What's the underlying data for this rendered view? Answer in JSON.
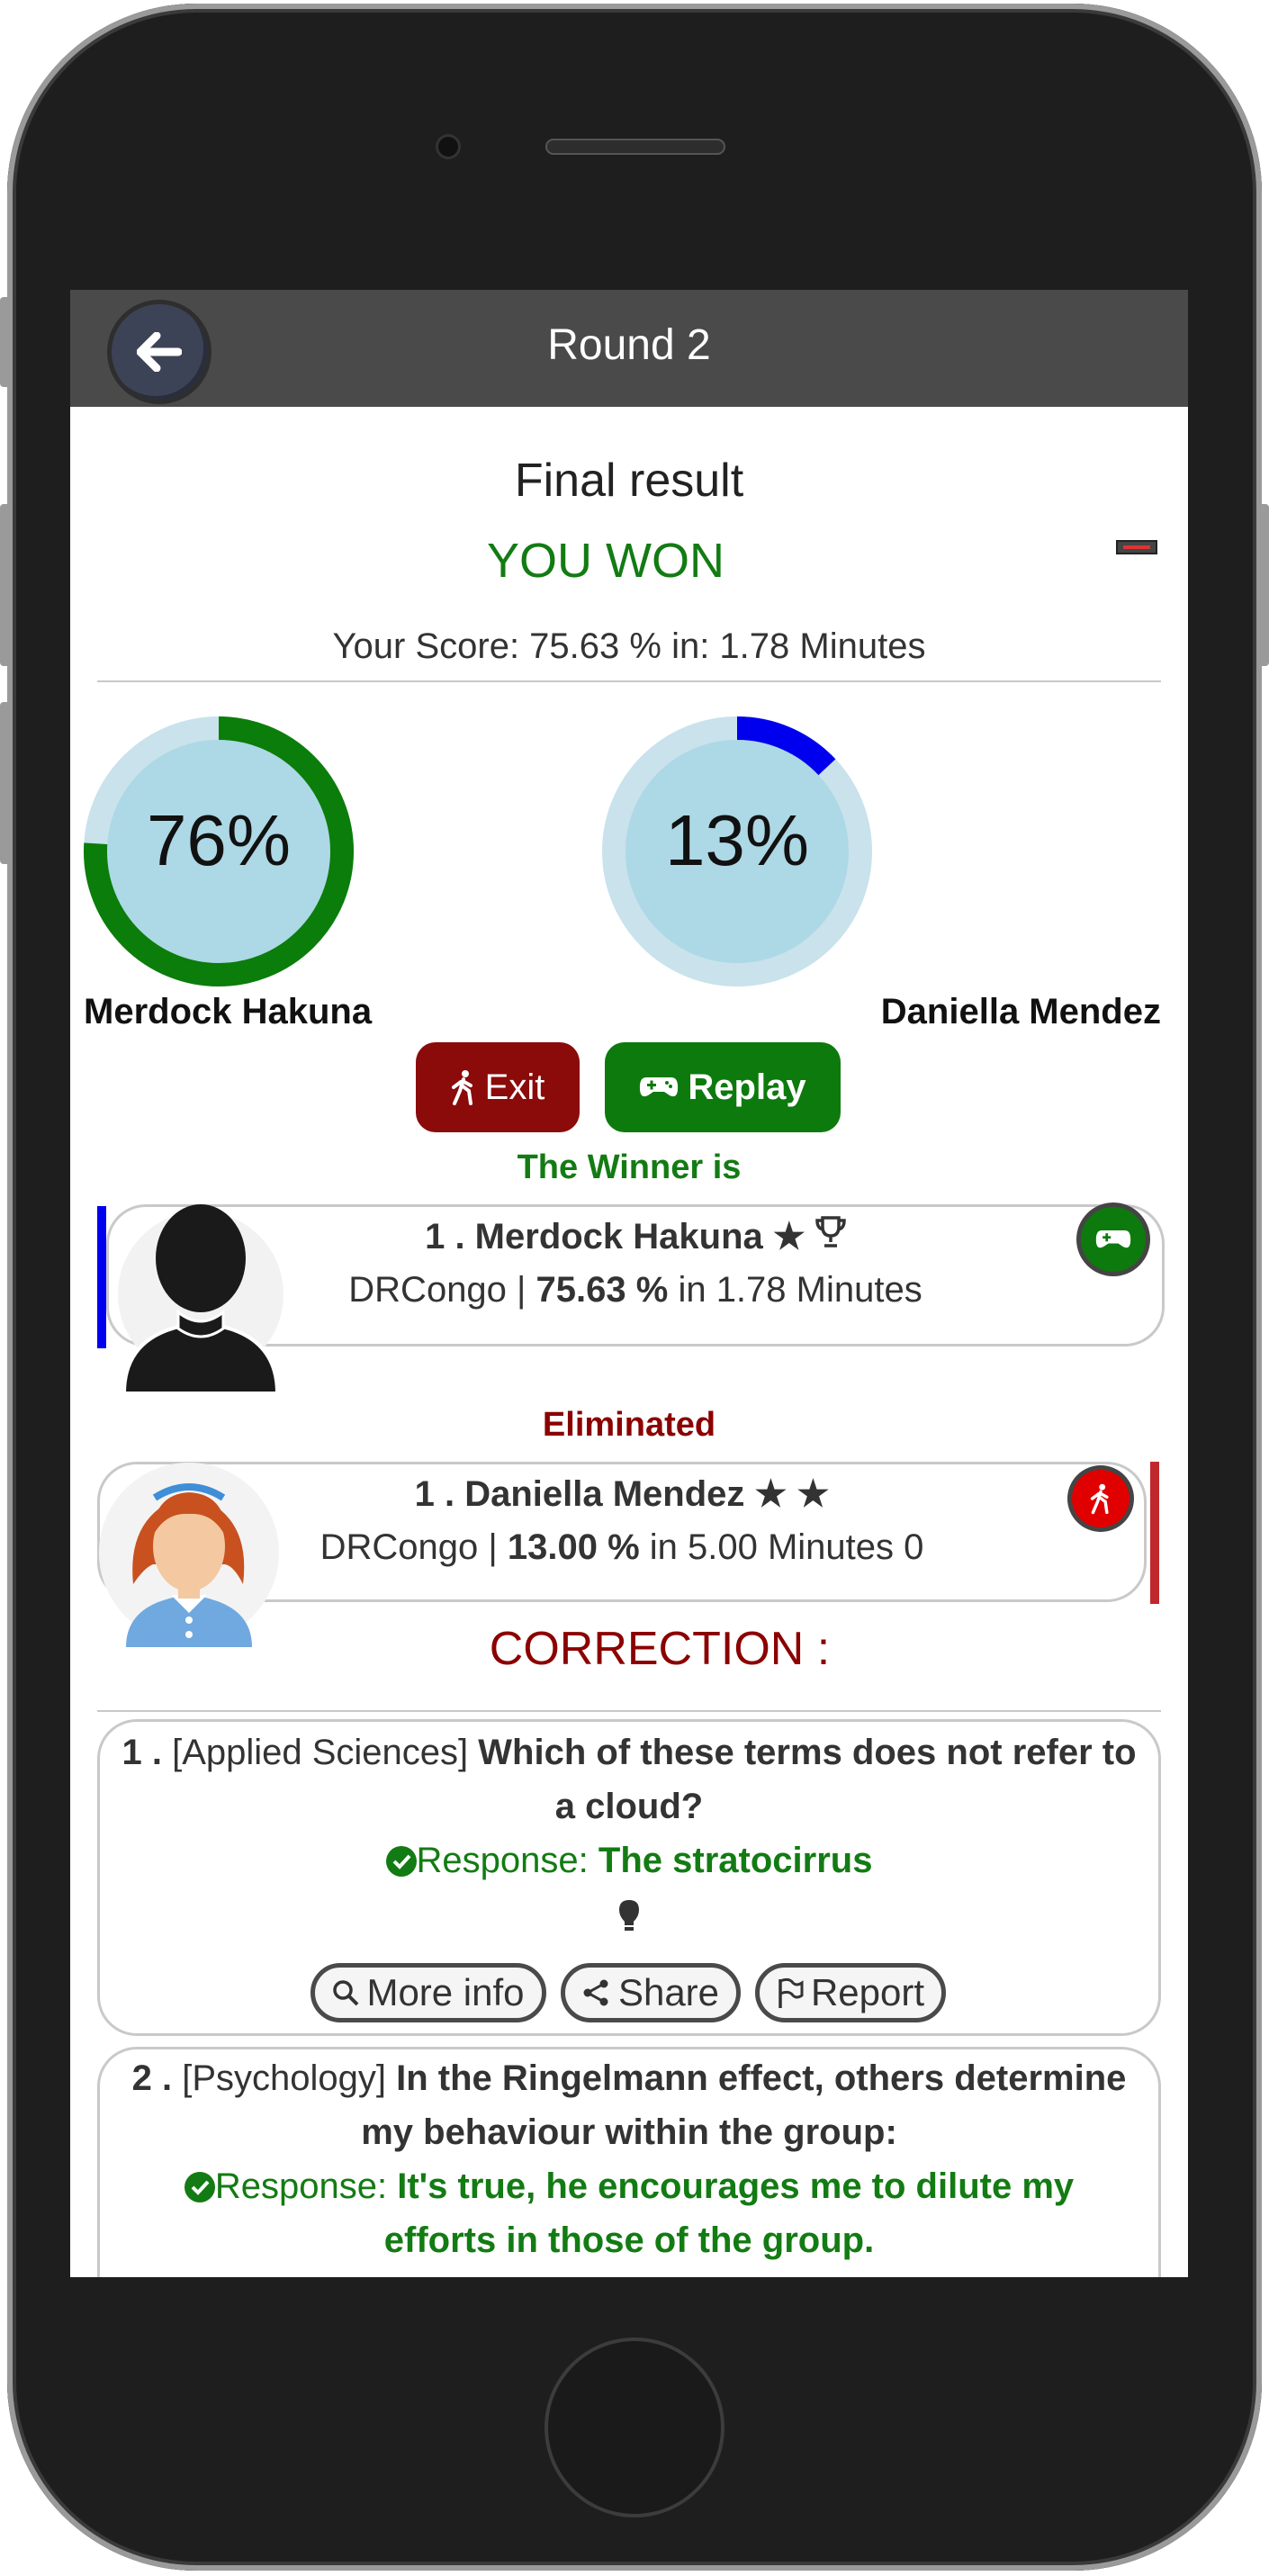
{
  "appbar": {
    "title": "Round 2",
    "back_icon": "arrow-left-icon"
  },
  "header": {
    "final_label": "Final result",
    "outcome": "YOU WON",
    "score_line": "Your Score: 75.63 % in: 1.78 Minutes"
  },
  "players": [
    {
      "percent_text": "76%",
      "percent": 0.76,
      "name": "Merdock Hakuna",
      "color": "#0a7d0a"
    },
    {
      "percent_text": "13%",
      "percent": 0.13,
      "name": "Daniella Mendez",
      "color": "#0000ee"
    }
  ],
  "actions": {
    "exit_label": "Exit",
    "replay_label": "Replay"
  },
  "winner": {
    "heading": "The Winner is",
    "rank_name": "1 . Merdock Hakuna",
    "marks": "★",
    "details_prefix": "DRCongo | ",
    "score": "75.63 %",
    "details_suffix": " in 1.78 Minutes"
  },
  "eliminated": {
    "heading": "Eliminated",
    "rank_name": "1 . Daniella Mendez",
    "marks": "★ ★",
    "details_prefix": "DRCongo | ",
    "score": "13.00 %",
    "details_suffix": " in 5.00 Minutes 0"
  },
  "correction": {
    "heading": "CORRECTION :",
    "questions": [
      {
        "num": "1 .",
        "category": "[Applied Sciences]",
        "question": "Which of these terms does not refer to a cloud?",
        "response_label": "Response:",
        "answer": "The stratocirrus",
        "buttons": {
          "more_info": "More info",
          "share": "Share",
          "report": "Report"
        }
      },
      {
        "num": "2 .",
        "category": "[Psychology]",
        "question": "In the Ringelmann effect, others determine my behaviour within the group:",
        "response_label": "Response:",
        "answer": "It's true, he encourages me to dilute my efforts in those of the group."
      }
    ]
  },
  "colors": {
    "win_green": "#137b13",
    "eliminated_red": "#8b0000",
    "replay_green": "#0d7a0d",
    "exit_red": "#8b0a0a"
  }
}
